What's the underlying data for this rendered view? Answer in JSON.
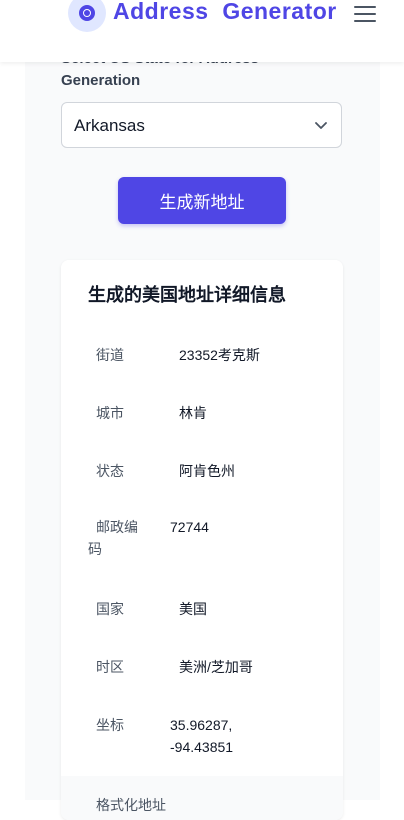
{
  "header": {
    "brand": "Address  Generator",
    "logo_icon": "target-icon",
    "menu_icon": "hamburger-icon"
  },
  "form": {
    "label": "Select US State for Address Generation",
    "selected_state": "Arkansas",
    "generate_button": "生成新地址"
  },
  "details": {
    "title": "生成的美国地址详细信息",
    "rows": [
      {
        "label": "街道",
        "value": "23352考克斯"
      },
      {
        "label": "城市",
        "value": "林肯"
      },
      {
        "label": "状态",
        "value": "阿肯色州"
      },
      {
        "label": "邮政编码",
        "value": "72744"
      },
      {
        "label": "国家",
        "value": "美国"
      },
      {
        "label": "时区",
        "value": "美洲/芝加哥"
      },
      {
        "label": "坐标",
        "value": "35.96287, -94.43851"
      },
      {
        "label": "格式化地址",
        "value": ""
      }
    ]
  },
  "colors": {
    "accent": "#4f46e5",
    "accent_light": "#e0e7ff"
  }
}
